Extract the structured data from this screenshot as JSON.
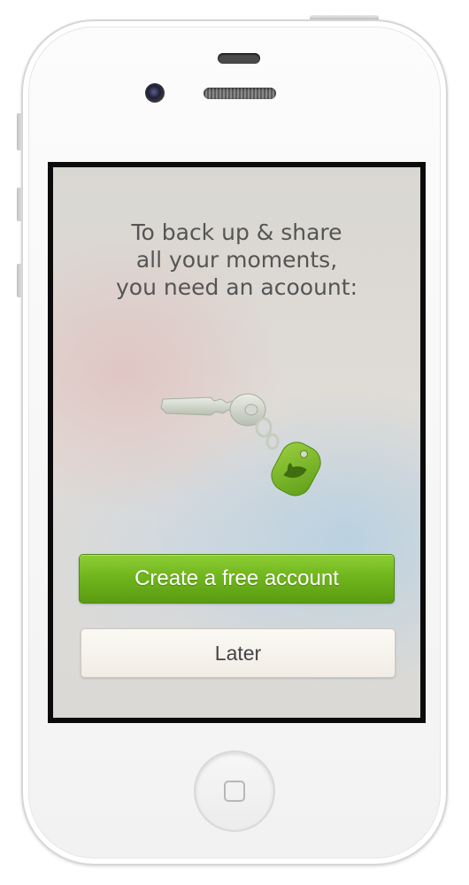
{
  "screen": {
    "headline_lines": [
      "To back up & share",
      "all your moments,",
      "you need an acoount:"
    ],
    "illustration_icon": "key-with-leaf-tag",
    "create_button_label": "Create a free account",
    "later_button_label": "Later"
  },
  "device": {
    "home_icon": "home-button-icon"
  },
  "colors": {
    "accent_green": "#6eb31c",
    "headline_text": "#555555"
  }
}
